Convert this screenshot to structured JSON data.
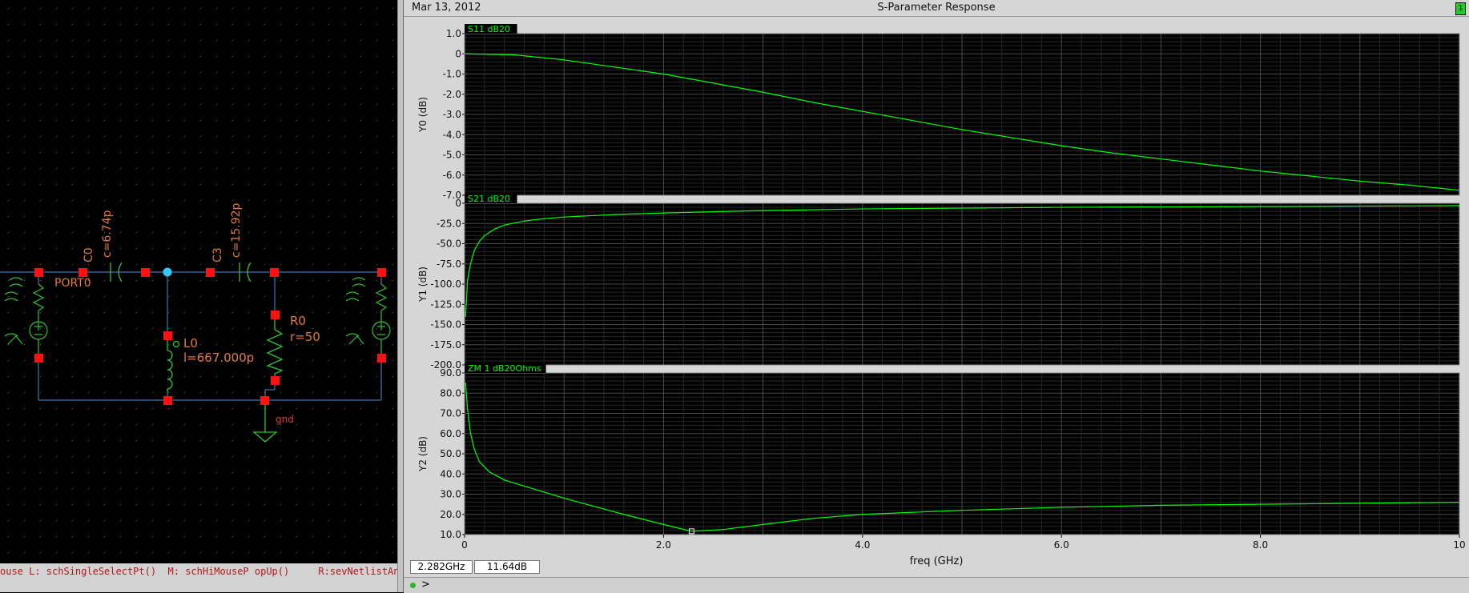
{
  "window": {
    "date": "Mar 13, 2012",
    "title": "S-Parameter Response",
    "subwindow_badge": "1"
  },
  "schematic": {
    "components": {
      "c0": {
        "name": "C0",
        "value": "c=6.74p"
      },
      "c3": {
        "name": "C3",
        "value": "c=15.92p"
      },
      "l0": {
        "name": "L0",
        "value": "l=667.000p"
      },
      "r0": {
        "name": "R0",
        "value": "r=50"
      },
      "port0": {
        "name": "PORT0"
      },
      "gnd": {
        "name": "gnd"
      }
    },
    "command_line": "ouse L: schSingleSelectPt()  M: schHiMouseP opUp()     R:sevNetlistAndRun"
  },
  "readout": {
    "x": "2.282GHz",
    "y": "11.64dB"
  },
  "statusbar": {
    "prompt": ">"
  },
  "chart_data": [
    {
      "type": "line",
      "legend": "S11 dB20",
      "ylabel": "Y0 (dB)",
      "xlabel": "freq (GHz)",
      "xlim": [
        0,
        10
      ],
      "ylim": [
        -7.0,
        1.0
      ],
      "yticks": [
        "1.0",
        "0",
        "-1.0",
        "-2.0",
        "-3.0",
        "-4.0",
        "-5.0",
        "-6.0",
        "-7.0"
      ],
      "x": [
        0,
        0.5,
        1,
        1.5,
        2,
        2.5,
        3,
        3.5,
        4,
        4.5,
        5,
        5.5,
        6,
        6.5,
        7,
        7.5,
        8,
        8.5,
        9,
        9.5,
        10
      ],
      "values": [
        0,
        -0.05,
        -0.3,
        -0.65,
        -1.0,
        -1.45,
        -1.9,
        -2.4,
        -2.85,
        -3.3,
        -3.75,
        -4.15,
        -4.55,
        -4.9,
        -5.2,
        -5.5,
        -5.8,
        -6.05,
        -6.3,
        -6.5,
        -6.75
      ],
      "color": "#00ff00"
    },
    {
      "type": "line",
      "legend": "S21 dB20",
      "ylabel": "Y1 (dB)",
      "xlabel": "freq (GHz)",
      "xlim": [
        0,
        10
      ],
      "ylim": [
        -200,
        0
      ],
      "yticks": [
        "0",
        "-25.0",
        "-50.0",
        "-75.0",
        "-100.0",
        "-125.0",
        "-150.0",
        "-175.0",
        "-200.0"
      ],
      "x": [
        0.01,
        0.03,
        0.06,
        0.1,
        0.15,
        0.2,
        0.3,
        0.4,
        0.6,
        0.8,
        1,
        1.5,
        2,
        3,
        4,
        5,
        6,
        7,
        8,
        9,
        10
      ],
      "values": [
        -140,
        -95,
        -75,
        -58,
        -47,
        -40,
        -32,
        -27,
        -22,
        -19,
        -17,
        -14,
        -12,
        -9,
        -7,
        -6,
        -5,
        -4.5,
        -4,
        -3.5,
        -3
      ],
      "color": "#00ff00"
    },
    {
      "type": "line",
      "legend": "ZM 1 dB20Ohms",
      "ylabel": "Y2 (dB)",
      "xlabel": "freq (GHz)",
      "xlim": [
        0,
        10
      ],
      "ylim": [
        10.0,
        90.0
      ],
      "yticks": [
        "90.0",
        "80.0",
        "70.0",
        "60.0",
        "50.0",
        "40.0",
        "30.0",
        "20.0",
        "10.0"
      ],
      "xticks": [
        "0",
        "2.0",
        "4.0",
        "6.0",
        "8.0",
        "10"
      ],
      "x": [
        0.01,
        0.03,
        0.06,
        0.1,
        0.15,
        0.25,
        0.4,
        0.6,
        0.8,
        1,
        1.3,
        1.6,
        2,
        2.282,
        2.6,
        3,
        3.5,
        4,
        5,
        6,
        7,
        8,
        9,
        10
      ],
      "values": [
        85,
        72,
        60,
        52,
        46,
        41,
        37,
        34,
        31,
        28,
        24,
        20,
        15,
        11.64,
        12.5,
        15,
        18,
        20,
        22,
        23.5,
        24.5,
        25,
        25.5,
        26
      ],
      "marker": {
        "x": 2.282,
        "y": 11.64
      },
      "color": "#00ff00"
    }
  ]
}
